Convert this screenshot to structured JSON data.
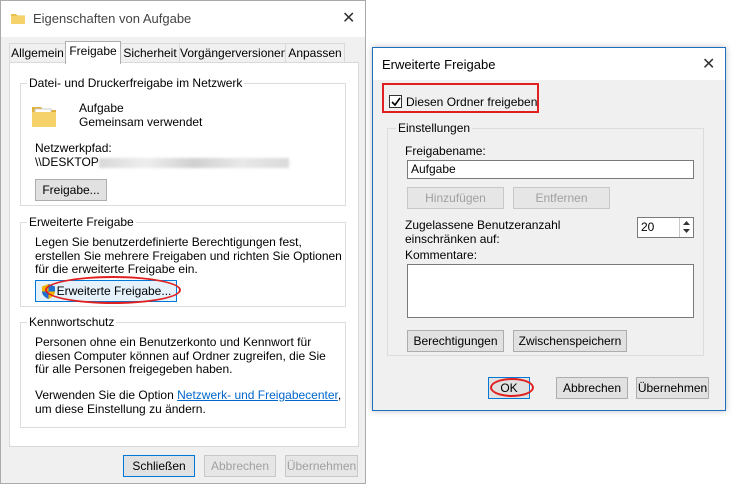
{
  "properties_dialog": {
    "title": "Eigenschaften von Aufgabe",
    "close_glyph": "✕",
    "tabs": [
      {
        "label": "Allgemein",
        "active": false
      },
      {
        "label": "Freigabe",
        "active": true
      },
      {
        "label": "Sicherheit",
        "active": false
      },
      {
        "label": "Vorgängerversionen",
        "active": false
      },
      {
        "label": "Anpassen",
        "active": false
      }
    ],
    "network_sharing": {
      "group_label": "Datei- und Druckerfreigabe im Netzwerk",
      "folder_name": "Aufgabe",
      "folder_status": "Gemeinsam verwendet",
      "path_label": "Netzwerkpfad:",
      "path_value": "\\\\DESKTOP",
      "share_button": "Freigabe..."
    },
    "advanced_sharing": {
      "group_label": "Erweiterte Freigabe",
      "description": "Legen Sie benutzerdefinierte Berechtigungen fest, erstellen Sie mehrere Freigaben und richten Sie Optionen für die erweiterte Freigabe ein.",
      "button": "Erweiterte Freigabe..."
    },
    "password_protection": {
      "group_label": "Kennwortschutz",
      "description": "Personen ohne ein Benutzerkonto und Kennwort für diesen Computer können auf Ordner zugreifen, die Sie für alle Personen freigegeben haben.",
      "link_prefix": "Verwenden Sie die Option ",
      "link_text": "Netzwerk- und Freigabecenter",
      "link_suffix": ", um diese Einstellung zu ändern."
    },
    "footer": {
      "close": "Schließen",
      "cancel": "Abbrechen",
      "apply": "Übernehmen"
    }
  },
  "advanced_dialog": {
    "title": "Erweiterte Freigabe",
    "close_glyph": "✕",
    "share_checkbox_label": "Diesen Ordner freigeben",
    "share_checked": true,
    "settings_label": "Einstellungen",
    "share_name_label": "Freigabename:",
    "share_name_value": "Aufgabe",
    "add_button": "Hinzufügen",
    "remove_button": "Entfernen",
    "limit_label": "Zugelassene Benutzeranzahl einschränken auf:",
    "limit_value": "20",
    "comments_label": "Kommentare:",
    "comments_value": "",
    "permissions_button": "Berechtigungen",
    "caching_button": "Zwischenspeichern",
    "ok": "OK",
    "cancel": "Abbrechen",
    "apply": "Übernehmen"
  },
  "colors": {
    "highlight_red": "#e02020",
    "link_blue": "#0066cc",
    "accent_border": "#1e6fc0"
  },
  "icons": {
    "title_folder": "folder-icon",
    "folder_large": "folder-icon",
    "uac_shield": "shield-icon",
    "checkbox": "checkmark-icon"
  }
}
